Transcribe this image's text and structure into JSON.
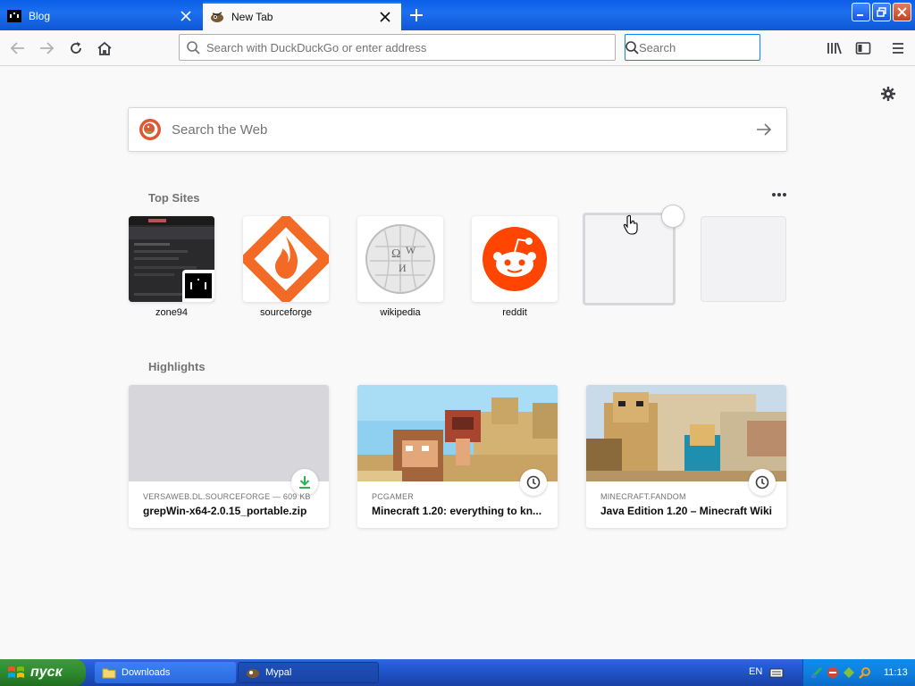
{
  "tabs": [
    {
      "title": "Blog",
      "active": false
    },
    {
      "title": "New Tab",
      "active": true
    }
  ],
  "navbar": {
    "url_placeholder": "Search with DuckDuckGo or enter address",
    "search_placeholder": "Search"
  },
  "content": {
    "web_search_placeholder": "Search the Web",
    "top_sites_title": "Top Sites",
    "highlights_title": "Highlights",
    "top_sites": [
      {
        "label": "zone94",
        "icon": "zone94-screenshot"
      },
      {
        "label": "sourceforge",
        "icon": "sourceforge-logo"
      },
      {
        "label": "wikipedia",
        "icon": "wikipedia-globe"
      },
      {
        "label": "reddit",
        "icon": "reddit-logo"
      }
    ],
    "highlights": [
      {
        "source": "VERSAWEB.DL.SOURCEFORGE — 609 KB",
        "title": "grepWin-x64-2.0.15_portable.zip",
        "badge": "download-icon"
      },
      {
        "source": "PCGAMER",
        "title": "Minecraft 1.20: everything to kn...",
        "badge": "clock-icon"
      },
      {
        "source": "MINECRAFT.FANDOM",
        "title": "Java Edition 1.20 – Minecraft Wiki",
        "badge": "clock-icon"
      }
    ]
  },
  "taskbar": {
    "start_label": "пуск",
    "buttons": [
      {
        "label": "Downloads",
        "icon": "folder-icon"
      },
      {
        "label": "Mypal",
        "icon": "mypal-icon"
      }
    ],
    "language": "EN",
    "clock": "11:13"
  },
  "colors": {
    "accent": "#0a84ff",
    "titlebar": "#1c6ff0",
    "sourceforge": "#f26a25",
    "reddit": "#ff4500",
    "download_green": "#2ac3a2"
  }
}
